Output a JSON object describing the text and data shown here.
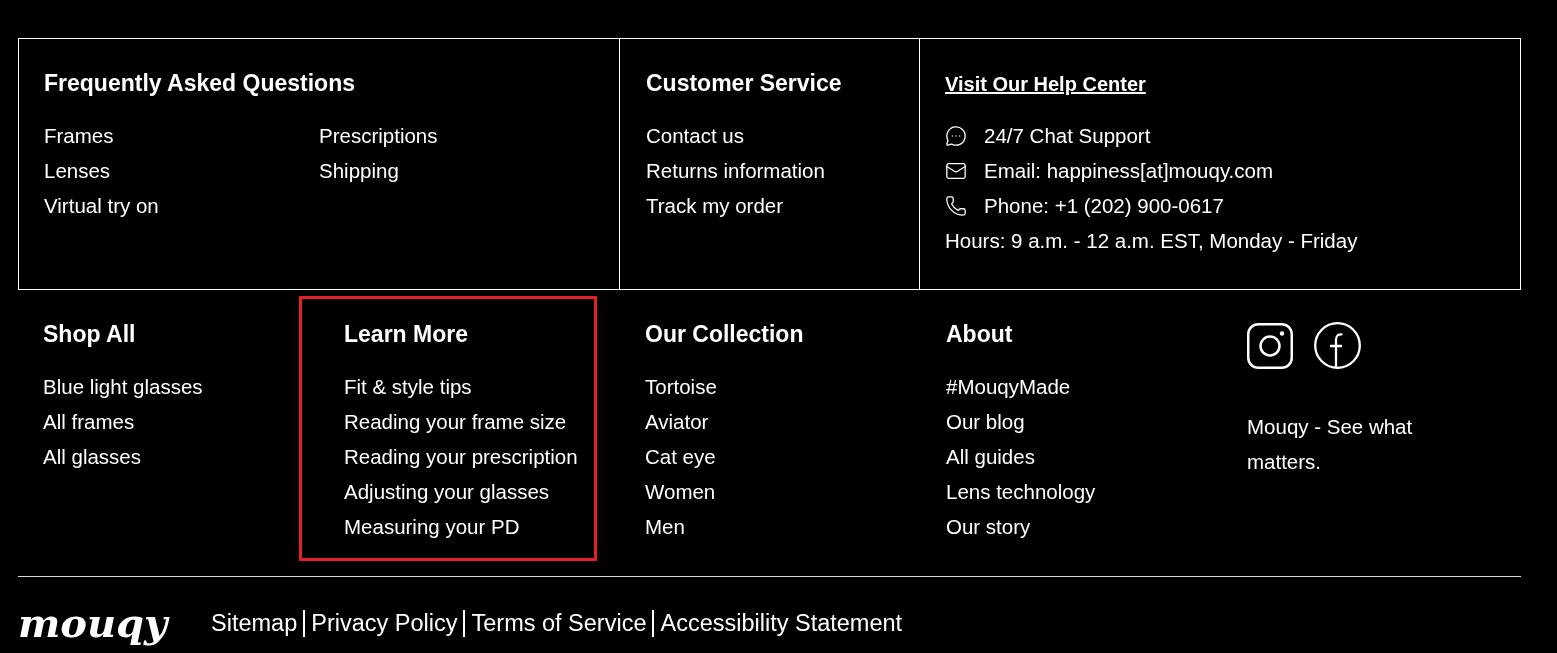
{
  "info_panel": {
    "faq": {
      "title": "Frequently Asked Questions",
      "columns": [
        [
          "Frames",
          "Lenses",
          "Virtual try on"
        ],
        [
          "Prescriptions",
          "Shipping"
        ]
      ]
    },
    "customer_service": {
      "title": "Customer Service",
      "links": [
        "Contact us",
        "Returns information",
        "Track my order"
      ]
    },
    "help_center": {
      "link": "Visit Our Help Center",
      "contacts": [
        {
          "kind": "chat",
          "text": "24/7 Chat Support"
        },
        {
          "kind": "email",
          "text": "Email: happiness[at]mouqy.com"
        },
        {
          "kind": "phone",
          "text": "Phone: +1 (202) 900-0617"
        }
      ],
      "hours": "Hours: 9 a.m. - 12 a.m. EST, Monday - Friday"
    }
  },
  "link_columns": [
    {
      "title": "Shop All",
      "highlighted": false,
      "links": [
        "Blue light glasses",
        "All frames",
        "All glasses"
      ]
    },
    {
      "title": "Learn More",
      "highlighted": true,
      "links": [
        "Fit & style tips",
        "Reading your frame size",
        "Reading your prescription",
        "Adjusting your glasses",
        "Measuring your PD"
      ]
    },
    {
      "title": "Our Collection",
      "highlighted": false,
      "links": [
        "Tortoise",
        "Aviator",
        "Cat eye",
        "Women",
        "Men"
      ]
    },
    {
      "title": "About",
      "highlighted": false,
      "links": [
        "#MouqyMade",
        "Our blog",
        "All guides",
        "Lens technology",
        "Our story"
      ]
    }
  ],
  "social": {
    "links": [
      {
        "kind": "instagram"
      },
      {
        "kind": "facebook"
      }
    ],
    "tagline": "Mouqy - See what matters."
  },
  "bottom_bar": {
    "logo": "mouqy",
    "links": [
      "Sitemap",
      "Privacy Policy",
      "Terms of Service",
      "Accessibility Statement"
    ]
  }
}
